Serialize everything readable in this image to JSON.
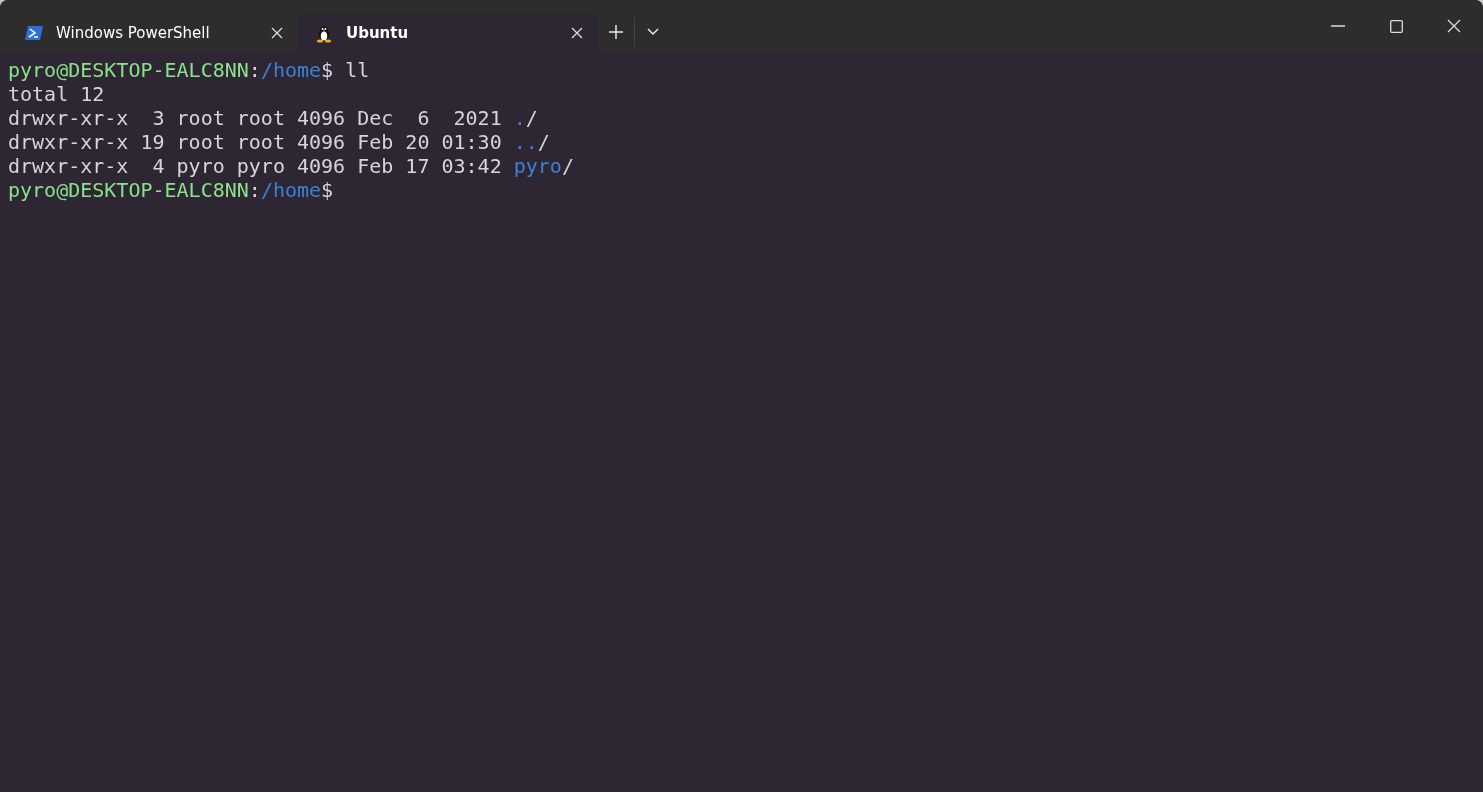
{
  "tabs": [
    {
      "label": "Windows PowerShell",
      "kind": "powershell",
      "selected": false
    },
    {
      "label": "Ubuntu",
      "kind": "linux",
      "selected": true
    }
  ],
  "terminal": {
    "lines": [
      [
        {
          "kind": "userhost",
          "text": "pyro@DESKTOP-EALC8NN"
        },
        {
          "kind": "text",
          "text": ":"
        },
        {
          "kind": "path",
          "text": "/home"
        },
        {
          "kind": "text",
          "text": "$ ll"
        }
      ],
      [
        {
          "kind": "text",
          "text": "total 12"
        }
      ],
      [
        {
          "kind": "text",
          "text": "drwxr-xr-x  3 root root 4096 Dec  6  2021 "
        },
        {
          "kind": "dir",
          "text": "."
        },
        {
          "kind": "text",
          "text": "/"
        }
      ],
      [
        {
          "kind": "text",
          "text": "drwxr-xr-x 19 root root 4096 Feb 20 01:30 "
        },
        {
          "kind": "dir",
          "text": ".."
        },
        {
          "kind": "text",
          "text": "/"
        }
      ],
      [
        {
          "kind": "text",
          "text": "drwxr-xr-x  4 pyro pyro 4096 Feb 17 03:42 "
        },
        {
          "kind": "dir",
          "text": "pyro"
        },
        {
          "kind": "text",
          "text": "/"
        }
      ],
      [
        {
          "kind": "userhost",
          "text": "pyro@DESKTOP-EALC8NN"
        },
        {
          "kind": "text",
          "text": ":"
        },
        {
          "kind": "path",
          "text": "/home"
        },
        {
          "kind": "text",
          "text": "$"
        }
      ]
    ]
  }
}
